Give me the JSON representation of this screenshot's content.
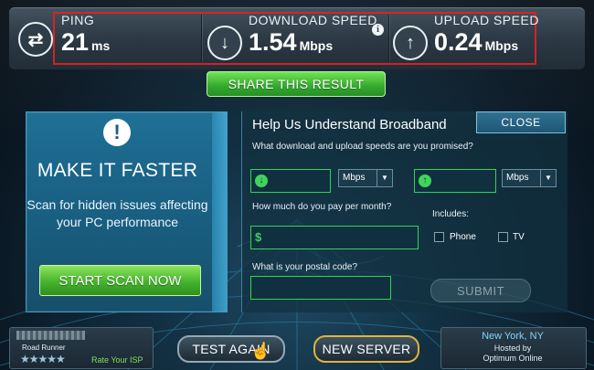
{
  "results": {
    "ping": {
      "label": "PING",
      "value": "21",
      "unit": "ms"
    },
    "download": {
      "label": "DOWNLOAD SPEED",
      "value": "1.54",
      "unit": "Mbps"
    },
    "upload": {
      "label": "UPLOAD SPEED",
      "value": "0.24",
      "unit": "Mbps"
    }
  },
  "share_label": "SHARE THIS RESULT",
  "promo": {
    "title": "MAKE IT FASTER",
    "text": "Scan for hidden issues affecting your PC performance",
    "button": "START SCAN NOW"
  },
  "form": {
    "title": "Help Us Understand Broadband",
    "close": "CLOSE",
    "q_speeds": "What download and upload speeds are you promised?",
    "download_unit": "Mbps",
    "upload_unit": "Mbps",
    "q_pay": "How much do you pay per month?",
    "currency": "$",
    "includes": "Includes:",
    "phone": "Phone",
    "tv": "TV",
    "q_postal": "What is your postal code?",
    "submit": "SUBMIT"
  },
  "isp": {
    "name": "Road Runner",
    "rate_label": "Rate Your ISP",
    "stars": "★★★★★"
  },
  "test_again": "TEST AGAIN",
  "new_server": "NEW SERVER",
  "server": {
    "city": "New York, NY",
    "hosted_by": "Hosted by",
    "host": "Optimum Online"
  },
  "colors": {
    "accent_green": "#3fd45c",
    "highlight_red": "#d11b1b",
    "server_gold": "#e0b33a"
  },
  "icons": [
    "switch-arrows-icon",
    "download-arrow-icon",
    "upload-arrow-icon",
    "info-icon",
    "exclamation-icon",
    "cursor-hand-icon"
  ]
}
